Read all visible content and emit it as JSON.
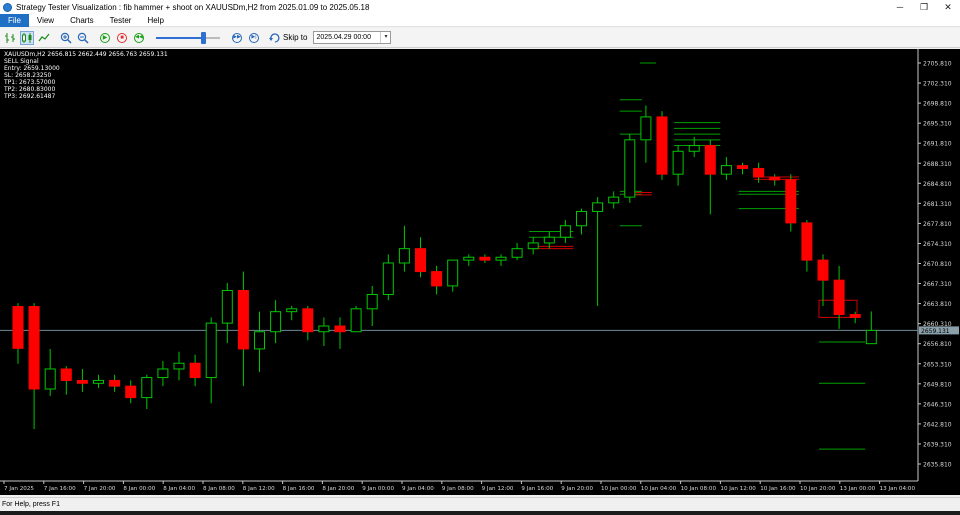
{
  "window": {
    "title": "Strategy Tester Visualization :  fib hammer + shoot on XAUUSDm,H2 from 2025.01.09 to 2025.05.18",
    "minimize": "─",
    "maximize": "❐",
    "close": "✕"
  },
  "menu": [
    "File",
    "View",
    "Charts",
    "Tester",
    "Help"
  ],
  "toolbar": {
    "skip_label": "Skip to",
    "skip_value": "2025.04.29 00:00",
    "speed": 0.73
  },
  "chart_data": {
    "type": "candlestick",
    "info_lines": [
      "XAUUSDm,H2  2656.815 2662.449 2656.763 2659.131",
      "SELL Signal",
      "Entry: 2659.13000",
      "SL: 2658.23250",
      "TP1: 2673.57000",
      "TP2: 2680.83000",
      "TP3: 2692.61487"
    ],
    "y_ticks": [
      "2705.810",
      "2702.310",
      "2698.810",
      "2695.310",
      "2691.810",
      "2688.310",
      "2684.810",
      "2681.310",
      "2677.810",
      "2674.310",
      "2670.810",
      "2667.310",
      "2663.810",
      "2660.310",
      "2656.810",
      "2653.310",
      "2649.810",
      "2646.310",
      "2642.810",
      "2639.310",
      "2635.810"
    ],
    "current_price": "2659.131",
    "x_ticks": [
      "7 Jan 2025",
      "7 Jan 16:00",
      "7 Jan 20:00",
      "8 Jan 00:00",
      "8 Jan 04:00",
      "8 Jan 08:00",
      "8 Jan 12:00",
      "8 Jan 16:00",
      "8 Jan 20:00",
      "9 Jan 00:00",
      "9 Jan 04:00",
      "9 Jan 08:00",
      "9 Jan 12:00",
      "9 Jan 16:00",
      "9 Jan 20:00",
      "10 Jan 00:00",
      "10 Jan 04:00",
      "10 Jan 08:00",
      "10 Jan 12:00",
      "10 Jan 16:00",
      "10 Jan 20:00",
      "13 Jan 00:00",
      "13 Jan 04:00"
    ],
    "colors": {
      "bull": "#00c800",
      "bear": "#ff0000",
      "price_line": "#6e8a99",
      "level_green": "#00a000",
      "level_red": "#d00000"
    },
    "candles": [
      {
        "o": 2663.3,
        "h": 2663.9,
        "l": 2653.3,
        "c": 2656.0
      },
      {
        "o": 2663.3,
        "h": 2663.9,
        "l": 2641.9,
        "c": 2648.9
      },
      {
        "o": 2648.9,
        "h": 2655.9,
        "l": 2647.7,
        "c": 2652.4
      },
      {
        "o": 2652.4,
        "h": 2652.9,
        "l": 2647.9,
        "c": 2650.4
      },
      {
        "o": 2650.4,
        "h": 2652.4,
        "l": 2648.4,
        "c": 2649.9
      },
      {
        "o": 2649.9,
        "h": 2651.4,
        "l": 2649.1,
        "c": 2650.4
      },
      {
        "o": 2650.4,
        "h": 2651.4,
        "l": 2648.4,
        "c": 2649.4
      },
      {
        "o": 2649.4,
        "h": 2650.4,
        "l": 2646.4,
        "c": 2647.4
      },
      {
        "o": 2647.4,
        "h": 2651.4,
        "l": 2645.4,
        "c": 2650.9
      },
      {
        "o": 2650.9,
        "h": 2653.8,
        "l": 2649.4,
        "c": 2652.4
      },
      {
        "o": 2652.4,
        "h": 2655.4,
        "l": 2650.4,
        "c": 2653.4
      },
      {
        "o": 2653.4,
        "h": 2654.9,
        "l": 2649.4,
        "c": 2650.9
      },
      {
        "o": 2650.9,
        "h": 2661.4,
        "l": 2646.4,
        "c": 2660.4
      },
      {
        "o": 2660.4,
        "h": 2667.4,
        "l": 2656.9,
        "c": 2666.1
      },
      {
        "o": 2666.1,
        "h": 2669.4,
        "l": 2649.4,
        "c": 2655.9
      },
      {
        "o": 2655.9,
        "h": 2662.4,
        "l": 2651.9,
        "c": 2658.9
      },
      {
        "o": 2658.9,
        "h": 2664.4,
        "l": 2656.9,
        "c": 2662.4
      },
      {
        "o": 2662.4,
        "h": 2663.4,
        "l": 2660.9,
        "c": 2662.9
      },
      {
        "o": 2662.9,
        "h": 2663.4,
        "l": 2657.4,
        "c": 2658.9
      },
      {
        "o": 2658.9,
        "h": 2661.4,
        "l": 2656.4,
        "c": 2659.9
      },
      {
        "o": 2659.9,
        "h": 2661.4,
        "l": 2655.9,
        "c": 2658.9
      },
      {
        "o": 2658.9,
        "h": 2663.4,
        "l": 2658.9,
        "c": 2662.9
      },
      {
        "o": 2662.9,
        "h": 2666.9,
        "l": 2659.9,
        "c": 2665.4
      },
      {
        "o": 2665.4,
        "h": 2672.4,
        "l": 2664.4,
        "c": 2670.9
      },
      {
        "o": 2670.9,
        "h": 2677.4,
        "l": 2669.4,
        "c": 2673.4
      },
      {
        "o": 2673.4,
        "h": 2675.4,
        "l": 2668.4,
        "c": 2669.4
      },
      {
        "o": 2669.4,
        "h": 2670.4,
        "l": 2665.4,
        "c": 2666.9
      },
      {
        "o": 2666.9,
        "h": 2671.4,
        "l": 2665.9,
        "c": 2671.4
      },
      {
        "o": 2671.4,
        "h": 2672.4,
        "l": 2670.4,
        "c": 2671.9
      },
      {
        "o": 2671.9,
        "h": 2672.4,
        "l": 2670.9,
        "c": 2671.4
      },
      {
        "o": 2671.4,
        "h": 2672.4,
        "l": 2670.4,
        "c": 2671.9
      },
      {
        "o": 2671.9,
        "h": 2674.4,
        "l": 2671.4,
        "c": 2673.4
      },
      {
        "o": 2673.4,
        "h": 2675.4,
        "l": 2672.4,
        "c": 2674.4
      },
      {
        "o": 2674.4,
        "h": 2676.4,
        "l": 2673.4,
        "c": 2675.4
      },
      {
        "o": 2675.4,
        "h": 2678.4,
        "l": 2674.4,
        "c": 2677.4
      },
      {
        "o": 2677.4,
        "h": 2680.4,
        "l": 2675.9,
        "c": 2679.9
      },
      {
        "o": 2679.9,
        "h": 2682.4,
        "l": 2663.4,
        "c": 2681.4
      },
      {
        "o": 2681.4,
        "h": 2683.4,
        "l": 2680.4,
        "c": 2682.4
      },
      {
        "o": 2682.4,
        "h": 2693.4,
        "l": 2681.4,
        "c": 2692.4
      },
      {
        "o": 2692.4,
        "h": 2698.4,
        "l": 2688.4,
        "c": 2696.4
      },
      {
        "o": 2696.4,
        "h": 2697.4,
        "l": 2685.4,
        "c": 2686.4
      },
      {
        "o": 2686.4,
        "h": 2691.4,
        "l": 2684.4,
        "c": 2690.4
      },
      {
        "o": 2690.4,
        "h": 2692.9,
        "l": 2689.4,
        "c": 2691.4
      },
      {
        "o": 2691.4,
        "h": 2692.4,
        "l": 2679.4,
        "c": 2686.4
      },
      {
        "o": 2686.4,
        "h": 2689.4,
        "l": 2685.4,
        "c": 2687.9
      },
      {
        "o": 2687.9,
        "h": 2688.4,
        "l": 2686.4,
        "c": 2687.4
      },
      {
        "o": 2687.4,
        "h": 2688.4,
        "l": 2684.9,
        "c": 2685.9
      },
      {
        "o": 2685.9,
        "h": 2686.4,
        "l": 2684.4,
        "c": 2685.4
      },
      {
        "o": 2685.4,
        "h": 2686.4,
        "l": 2676.4,
        "c": 2677.9
      },
      {
        "o": 2677.9,
        "h": 2678.4,
        "l": 2669.4,
        "c": 2671.4
      },
      {
        "o": 2671.4,
        "h": 2672.4,
        "l": 2663.4,
        "c": 2667.9
      },
      {
        "o": 2667.9,
        "h": 2670.4,
        "l": 2659.4,
        "c": 2661.9
      },
      {
        "o": 2661.9,
        "h": 2662.4,
        "l": 2660.4,
        "c": 2661.4
      },
      {
        "o": 2656.815,
        "h": 2662.449,
        "l": 2656.763,
        "c": 2659.131
      }
    ]
  },
  "status": "For Help, press F1"
}
